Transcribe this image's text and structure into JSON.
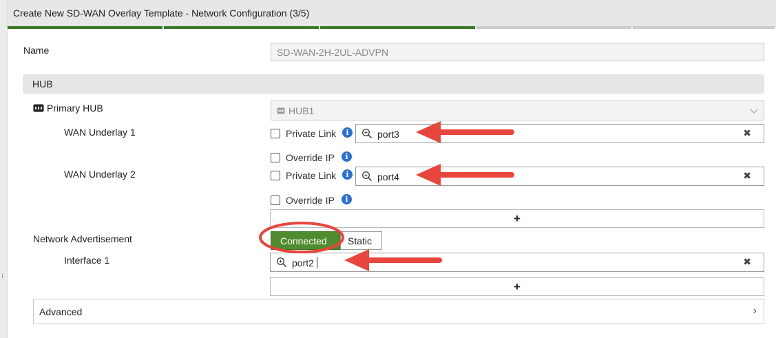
{
  "window": {
    "title": "Create New SD-WAN Overlay Template - Network Configuration (3/5)"
  },
  "progress": {
    "steps_total": 5,
    "steps_done": 3
  },
  "name_row": {
    "label": "Name",
    "value": "SD-WAN-2H-2UL-ADVPN"
  },
  "hub_section": {
    "title": "HUB"
  },
  "primary_hub": {
    "label": "Primary HUB",
    "value": "HUB1"
  },
  "wan_underlay_1": {
    "label": "WAN Underlay 1",
    "private_link_label": "Private Link",
    "interface": "port3",
    "override_ip_label": "Override IP"
  },
  "wan_underlay_2": {
    "label": "WAN Underlay 2",
    "private_link_label": "Private Link",
    "interface": "port4",
    "override_ip_label": "Override IP"
  },
  "network_advertisement": {
    "label": "Network Advertisement",
    "options": [
      "Connected",
      "Static"
    ],
    "selected": "Connected"
  },
  "interface_1": {
    "label": "Interface 1",
    "value": "port2"
  },
  "advanced": {
    "label": "Advanced"
  },
  "icons": {
    "add": "+",
    "clear": "✖",
    "chevron_right": "›",
    "info": "i"
  },
  "colors": {
    "accent_green": "#4f8c2f",
    "annotation_red": "#e8453c",
    "info_blue": "#2a6fd6"
  }
}
